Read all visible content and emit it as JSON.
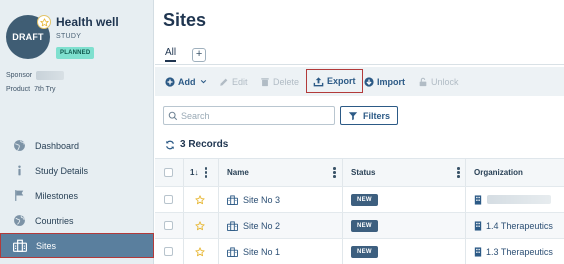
{
  "study": {
    "avatar_text": "DRAFT",
    "name": "Health well",
    "type": "STUDY",
    "status": "PLANNED",
    "sponsor_label": "Sponsor",
    "product_label": "Product",
    "product_value": "7th Try"
  },
  "nav": {
    "items": [
      {
        "label": "Dashboard",
        "icon": "globe-icon"
      },
      {
        "label": "Study Details",
        "icon": "info-icon"
      },
      {
        "label": "Milestones",
        "icon": "flag-icon"
      },
      {
        "label": "Countries",
        "icon": "globe-icon"
      },
      {
        "label": "Sites",
        "icon": "building-icon"
      }
    ],
    "active": "Sites"
  },
  "page": {
    "title": "Sites",
    "tab_all": "All",
    "tab_add": "+"
  },
  "toolbar": {
    "add": "Add",
    "edit": "Edit",
    "delete": "Delete",
    "export": "Export",
    "import": "Import",
    "unlock": "Unlock"
  },
  "search": {
    "placeholder": "Search",
    "filters_label": "Filters"
  },
  "records": {
    "label": "3 Records"
  },
  "table": {
    "sort_label": "1↓",
    "columns": {
      "name": "Name",
      "status": "Status",
      "organization": "Organization"
    },
    "rows": [
      {
        "name": "Site No 3",
        "status": "NEW",
        "organization": ""
      },
      {
        "name": "Site No 2",
        "status": "NEW",
        "organization": "1.4 Therapeutics"
      },
      {
        "name": "Site No 1",
        "status": "NEW",
        "organization": "1.3 Therapeutics"
      }
    ]
  },
  "colors": {
    "sidebar_bg": "#e7eef2",
    "active_nav": "#5a7f9e",
    "primary_blue": "#2c5a86",
    "highlight_border": "#b23a3a",
    "planned_pill": "#7fe0cf",
    "new_badge": "#3d5f7f",
    "star": "#e8b93a"
  }
}
